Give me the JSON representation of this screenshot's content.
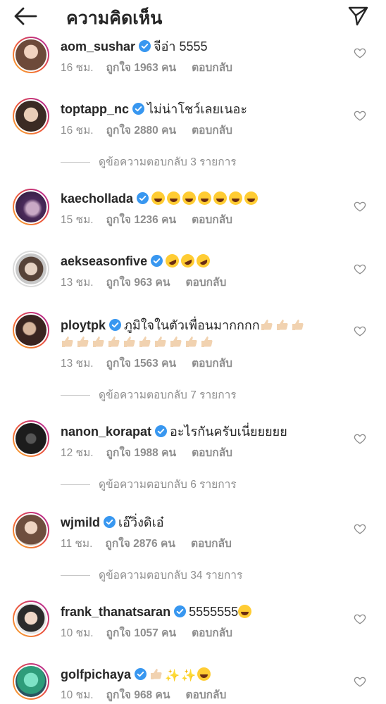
{
  "header": {
    "title": "ความคิดเห็น",
    "back_icon": "arrow-left-icon",
    "send_icon": "paper-plane-icon"
  },
  "colors": {
    "text": "#262626",
    "meta": "#8e8e8e",
    "verified": "#3897f0",
    "story_ring_start": "#f9b233",
    "story_ring_end": "#b32fa0"
  },
  "comments": [
    {
      "username": "aom_sushar",
      "text": "จีอ่า 5555",
      "time": "16 ชม.",
      "likes": "ถูกใจ 1963 คน",
      "reply": "ตอบกลับ"
    },
    {
      "username": "toptapp_nc",
      "text": "ไม่น่าโชว์เลยเนอะ",
      "time": "16 ชม.",
      "likes": "ถูกใจ 2880 คน",
      "reply": "ตอบกลับ",
      "view_replies": "ดูข้อความตอบกลับ 3 รายการ"
    },
    {
      "username": "kaechollada",
      "text": "",
      "emoji": [
        "laugh",
        "laugh",
        "laugh",
        "laugh",
        "laugh",
        "laugh",
        "laugh"
      ],
      "time": "15 ชม.",
      "likes": "ถูกใจ 1236 คน",
      "reply": "ตอบกลับ"
    },
    {
      "username": "aekseasonfive",
      "text": "",
      "emoji": [
        "rofl",
        "rofl",
        "rofl"
      ],
      "time": "13 ชม.",
      "likes": "ถูกใจ 963 คน",
      "reply": "ตอบกลับ"
    },
    {
      "username": "ploytpk",
      "text": "ภูมิใจในตัวเพื่อนมากกกก",
      "time": "13 ชม.",
      "likes": "ถูกใจ 1563 คน",
      "reply": "ตอบกลับ",
      "view_replies": "ดูข้อความตอบกลับ 7 รายการ"
    },
    {
      "username": "nanon_korapat",
      "text": "อะไรกันครับเนี่ยยยยย",
      "time": "12 ชม.",
      "likes": "ถูกใจ 1988 คน",
      "reply": "ตอบกลับ",
      "view_replies": "ดูข้อความตอบกลับ 6 รายการ"
    },
    {
      "username": "wjmild",
      "text": "เอ๊วิ่งดิเอ๋",
      "time": "11 ชม.",
      "likes": "ถูกใจ 2876 คน",
      "reply": "ตอบกลับ",
      "view_replies": "ดูข้อความตอบกลับ 34 รายการ"
    },
    {
      "username": "frank_thanatsaran",
      "text": "5555555",
      "emoji": [
        "laugh"
      ],
      "time": "10 ชม.",
      "likes": "ถูกใจ 1057 คน",
      "reply": "ตอบกลับ"
    },
    {
      "username": "golfpichaya",
      "text": "",
      "emoji": [
        "thumb",
        "sparkle",
        "sparkle",
        "laugh"
      ],
      "time": "10 ชม.",
      "likes": "ถูกใจ 968 คน",
      "reply": "ตอบกลับ"
    }
  ]
}
